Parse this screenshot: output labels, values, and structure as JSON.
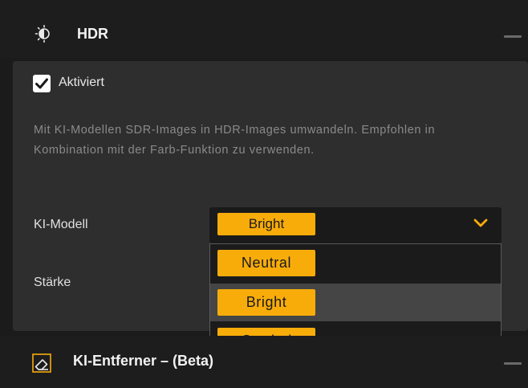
{
  "hdr_section": {
    "title": "HDR",
    "icon": "sun-half-icon",
    "collapse_icon": "minus-icon",
    "enabled_checked": true,
    "enabled_label": "Aktiviert",
    "description": "Mit KI-Modellen SDR-Images in HDR-Images umwandeln. Empfohlen in Kombination mit der Farb-Funktion zu verwenden.",
    "model_label": "KI-Modell",
    "model_selected": "Bright",
    "model_options": [
      "Neutral",
      "Bright",
      "Graded"
    ],
    "strength_label": "Stärke"
  },
  "next_section": {
    "title": "KI-Entferner – (Beta)",
    "icon": "eraser-icon",
    "collapse_icon": "minus-icon"
  },
  "colors": {
    "accent": "#f8ac0a",
    "panel_bg": "#2e2e2e",
    "header_bg": "#1d1d1d"
  }
}
